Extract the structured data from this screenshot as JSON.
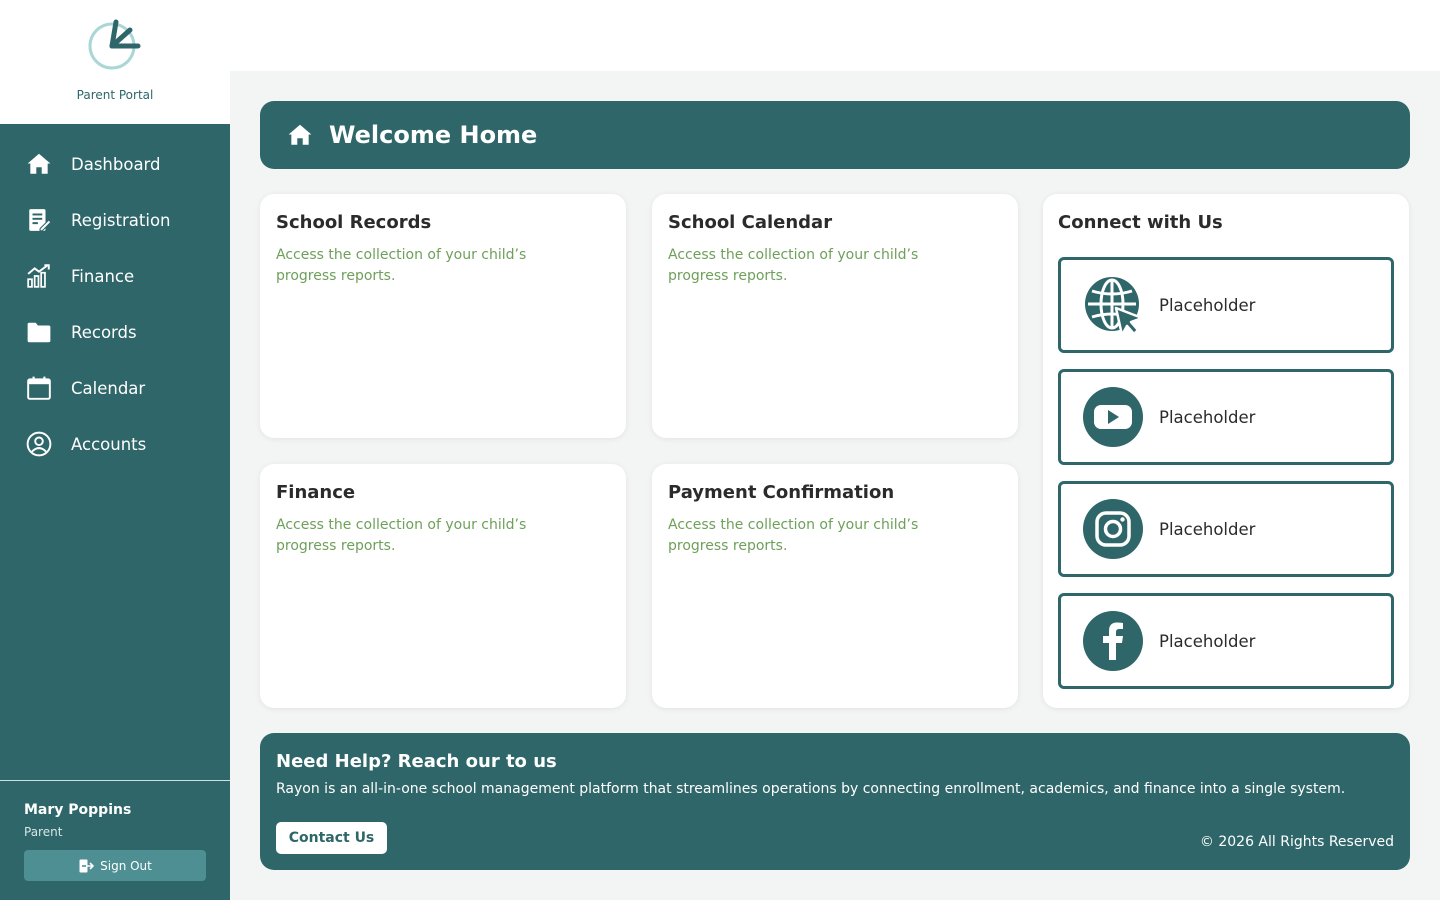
{
  "brand": {
    "name": "Parent Portal",
    "logo_icon": "clock-arrow-logo-icon"
  },
  "sidebar": {
    "items": [
      {
        "label": "Dashboard",
        "icon": "home-icon"
      },
      {
        "label": "Registration",
        "icon": "edit-document-icon"
      },
      {
        "label": "Finance",
        "icon": "chart-growth-icon"
      },
      {
        "label": "Records",
        "icon": "folder-icon"
      },
      {
        "label": "Calendar",
        "icon": "calendar-icon"
      },
      {
        "label": "Accounts",
        "icon": "user-circle-icon"
      }
    ]
  },
  "user": {
    "name": "Mary Poppins",
    "role": "Parent",
    "signout_label": "Sign Out"
  },
  "welcome": {
    "title": "Welcome Home",
    "icon": "home-icon"
  },
  "cards": [
    {
      "title": "School Records",
      "description": "Access the collection of your child’s progress reports."
    },
    {
      "title": "School Calendar",
      "description": "Access the collection of your child’s progress reports."
    },
    {
      "title": "Finance",
      "description": "Access the collection of your child’s progress reports."
    },
    {
      "title": "Payment Confirmation",
      "description": "Access the collection of your child’s progress reports."
    }
  ],
  "connect": {
    "title": "Connect with Us",
    "links": [
      {
        "label": "Placeholder",
        "icon": "globe-icon"
      },
      {
        "label": "Placeholder",
        "icon": "youtube-icon"
      },
      {
        "label": "Placeholder",
        "icon": "instagram-icon"
      },
      {
        "label": "Placeholder",
        "icon": "facebook-icon"
      }
    ]
  },
  "help": {
    "title": "Need Help? Reach our to us",
    "text": "Rayon is an all-in-one school management platform that streamlines operations by connecting enrollment, academics, and finance into a single system.",
    "contact_label": "Contact Us",
    "copyright": "© 2026 All Rights Reserved"
  },
  "colors": {
    "primary": "#2e6669",
    "accent_text": "#6ea05a",
    "background": "#f3f4f4"
  }
}
